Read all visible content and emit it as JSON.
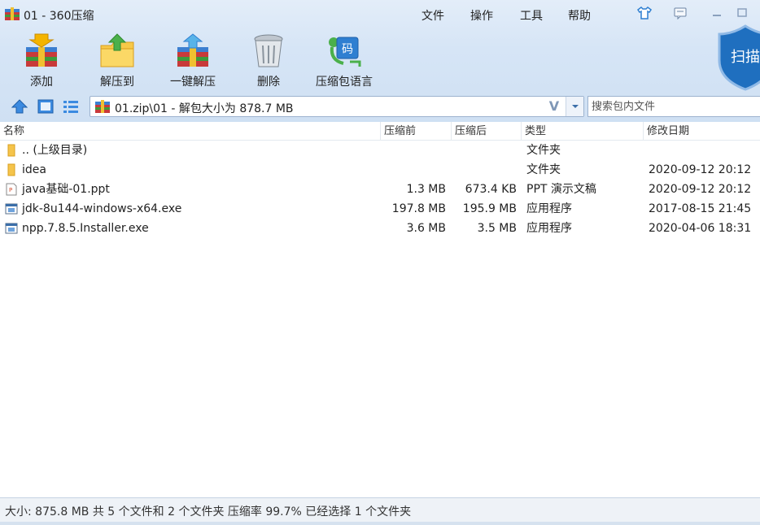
{
  "window": {
    "title": "01 - 360压缩",
    "menu": [
      "文件",
      "操作",
      "工具",
      "帮助"
    ]
  },
  "toolbar": {
    "add": "添加",
    "extract_to": "解压到",
    "one_click_extract": "一键解压",
    "delete": "删除",
    "encoding": "压缩包语言",
    "scan": "扫描"
  },
  "address": {
    "path": "01.zip\\01 - 解包大小为 878.7 MB",
    "v_label": "V"
  },
  "search": {
    "placeholder": "搜索包内文件"
  },
  "columns": {
    "name": "名称",
    "packed": "压缩前",
    "compressed": "压缩后",
    "type": "类型",
    "modified": "修改日期"
  },
  "files": [
    {
      "name": ".. (上级目录)",
      "packed": "",
      "compressed": "",
      "type": "文件夹",
      "modified": "",
      "icon": "folder-icon"
    },
    {
      "name": "idea",
      "packed": "",
      "compressed": "",
      "type": "文件夹",
      "modified": "2020-09-12 20:12",
      "icon": "folder-icon"
    },
    {
      "name": "java基础-01.ppt",
      "packed": "1.3 MB",
      "compressed": "673.4 KB",
      "type": "PPT 演示文稿",
      "modified": "2020-09-12 20:12",
      "icon": "ppt-file-icon"
    },
    {
      "name": "jdk-8u144-windows-x64.exe",
      "packed": "197.8 MB",
      "compressed": "195.9 MB",
      "type": "应用程序",
      "modified": "2017-08-15 21:45",
      "icon": "exe-file-icon"
    },
    {
      "name": "npp.7.8.5.Installer.exe",
      "packed": "3.6 MB",
      "compressed": "3.5 MB",
      "type": "应用程序",
      "modified": "2020-04-06 18:31",
      "icon": "exe-file-icon"
    }
  ],
  "status": {
    "text": "大小: 875.8 MB 共 5 个文件和 2 个文件夹 压缩率 99.7% 已经选择 1 个文件夹"
  },
  "colors": {
    "chrome": "#d6e5f6",
    "accent": "#2f7fd1",
    "folder": "#f5c44b"
  }
}
